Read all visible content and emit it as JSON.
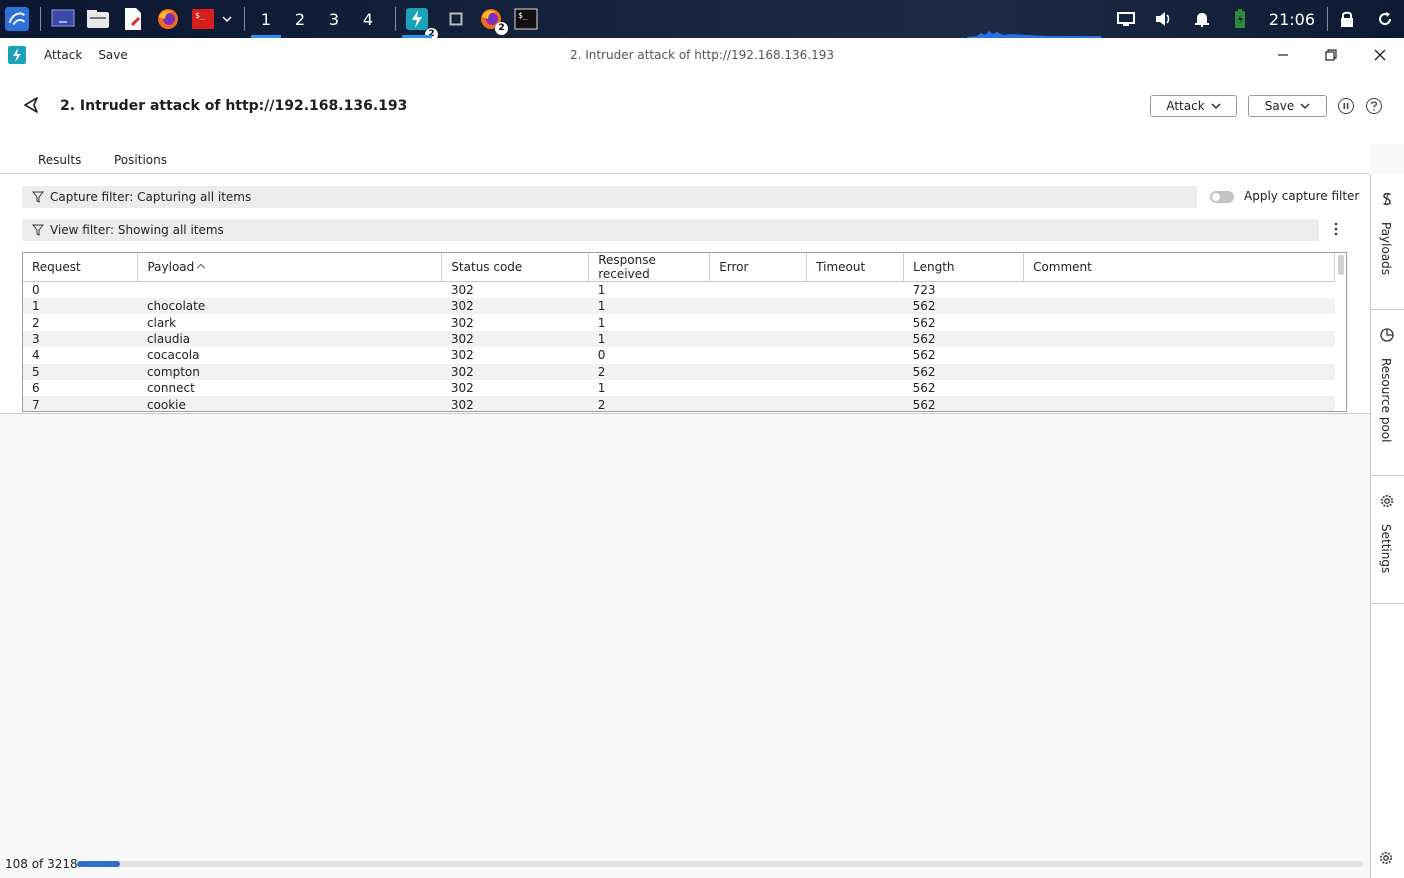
{
  "taskbar": {
    "workspaces": [
      "1",
      "2",
      "3",
      "4"
    ],
    "burp_badge": "2",
    "firefox_badge": "2",
    "clock": "21:06"
  },
  "titlebar": {
    "menu_attack": "Attack",
    "menu_save": "Save",
    "window_title": "2. Intruder attack of http://192.168.136.193"
  },
  "header": {
    "title": "2. Intruder attack of http://192.168.136.193",
    "attack_label": "Attack",
    "save_label": "Save"
  },
  "tabs": [
    "Results",
    "Positions"
  ],
  "filters": {
    "capture": "Capture filter: Capturing all items",
    "view": "View filter: Showing all items",
    "apply_capture": "Apply capture filter"
  },
  "table": {
    "columns": [
      "Request",
      "Payload",
      "Status code",
      "Response received",
      "Error",
      "Timeout",
      "Length",
      "Comment"
    ],
    "rows": [
      [
        "0",
        "",
        "302",
        "1",
        "",
        "",
        "723",
        ""
      ],
      [
        "1",
        "chocolate",
        "302",
        "1",
        "",
        "",
        "562",
        ""
      ],
      [
        "2",
        "clark",
        "302",
        "1",
        "",
        "",
        "562",
        ""
      ],
      [
        "3",
        "claudia",
        "302",
        "1",
        "",
        "",
        "562",
        ""
      ],
      [
        "4",
        "cocacola",
        "302",
        "0",
        "",
        "",
        "562",
        ""
      ],
      [
        "5",
        "compton",
        "302",
        "2",
        "",
        "",
        "562",
        ""
      ],
      [
        "6",
        "connect",
        "302",
        "1",
        "",
        "",
        "562",
        ""
      ],
      [
        "7",
        "cookie",
        "302",
        "2",
        "",
        "",
        "562",
        ""
      ]
    ]
  },
  "side_panel": {
    "payloads": "Payloads",
    "resource_pool": "Resource pool",
    "settings": "Settings"
  },
  "status": {
    "progress_text": "108 of 3218",
    "progress_done": 108,
    "progress_total": 3218
  },
  "colors": {
    "accent_tab": "#e8622a",
    "progress": "#2e6fc7",
    "burp_logo": "#1aa3b8"
  }
}
